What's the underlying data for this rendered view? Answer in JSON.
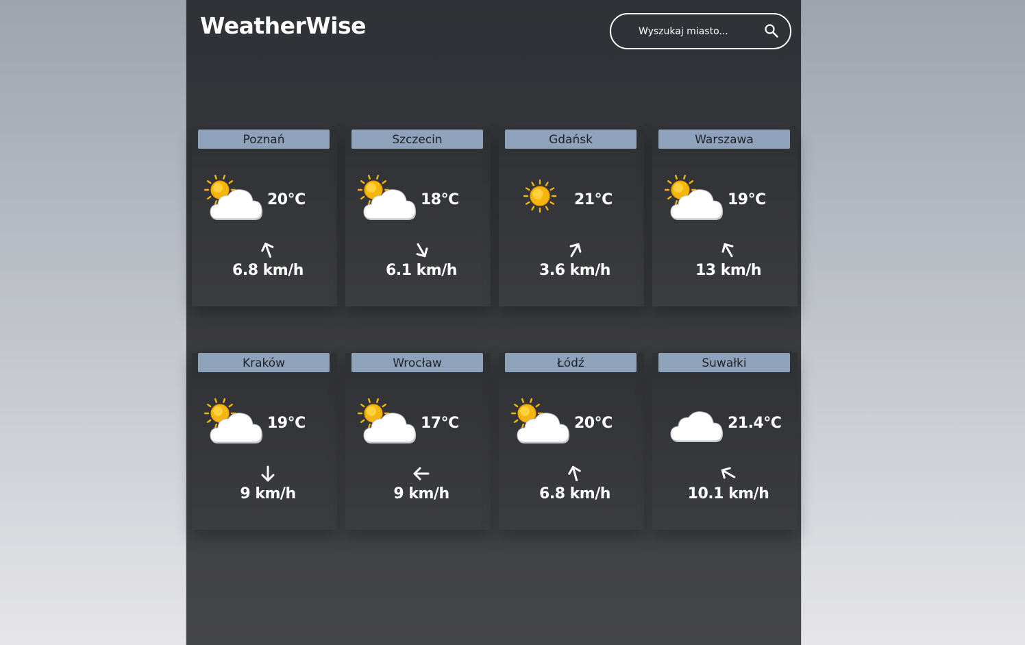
{
  "app": {
    "title": "WeatherWise"
  },
  "search": {
    "placeholder": "Wyszukaj miasto...",
    "value": ""
  },
  "colors": {
    "background_top": "#9ea3ad",
    "background_bottom": "#e6e6e9",
    "panel": "#303136",
    "card": "#343538",
    "city_label_bg": "#8fa2bb",
    "text": "#ffffff",
    "sun": "#f5b50a",
    "cloud": "#ffffff"
  },
  "cities": [
    {
      "name": "Poznań",
      "temperature": "20°C",
      "icon": "partly-cloudy",
      "wind_direction_deg": 340,
      "wind_speed": "6.8 km/h"
    },
    {
      "name": "Szczecin",
      "temperature": "18°C",
      "icon": "partly-cloudy",
      "wind_direction_deg": 150,
      "wind_speed": "6.1 km/h"
    },
    {
      "name": "Gdańsk",
      "temperature": "21°C",
      "icon": "sunny",
      "wind_direction_deg": 30,
      "wind_speed": "3.6 km/h"
    },
    {
      "name": "Warszawa",
      "temperature": "19°C",
      "icon": "partly-cloudy",
      "wind_direction_deg": 330,
      "wind_speed": "13 km/h"
    },
    {
      "name": "Kraków",
      "temperature": "19°C",
      "icon": "partly-cloudy",
      "wind_direction_deg": 180,
      "wind_speed": "9 km/h"
    },
    {
      "name": "Wrocław",
      "temperature": "17°C",
      "icon": "partly-cloudy",
      "wind_direction_deg": 270,
      "wind_speed": "9 km/h"
    },
    {
      "name": "Łódź",
      "temperature": "20°C",
      "icon": "partly-cloudy",
      "wind_direction_deg": 345,
      "wind_speed": "6.8 km/h"
    },
    {
      "name": "Suwałki",
      "temperature": "21.4°C",
      "icon": "cloudy",
      "wind_direction_deg": 300,
      "wind_speed": "10.1 km/h"
    }
  ]
}
